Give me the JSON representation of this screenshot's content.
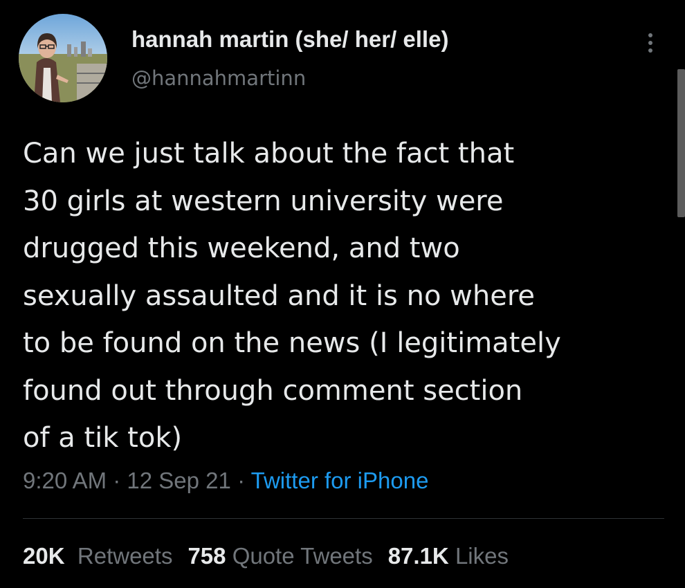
{
  "user": {
    "display_name": "hannah martin (she/ her/ elle)",
    "handle": "@hannahmartinn",
    "avatar_icon": "profile-photo"
  },
  "tweet": {
    "text": "Can we just talk about the fact that\n30 girls at western university were\ndrugged this weekend, and two\nsexually assaulted and it is no where\nto be found on the news (I legitimately\nfound out through comment section\nof a tik tok)"
  },
  "meta": {
    "time": "9:20 AM",
    "separator": "·",
    "date": "12 Sep 21",
    "source": "Twitter for iPhone"
  },
  "stats": {
    "retweets": {
      "count": "20K",
      "label": "Retweets"
    },
    "quotes": {
      "count": "758",
      "label": "Quote Tweets"
    },
    "likes": {
      "count": "87.1K",
      "label": "Likes"
    }
  },
  "colors": {
    "background": "#000000",
    "text": "#e7e9ea",
    "secondary": "#71767b",
    "link": "#1d9bf0",
    "divider": "#2f3336"
  }
}
